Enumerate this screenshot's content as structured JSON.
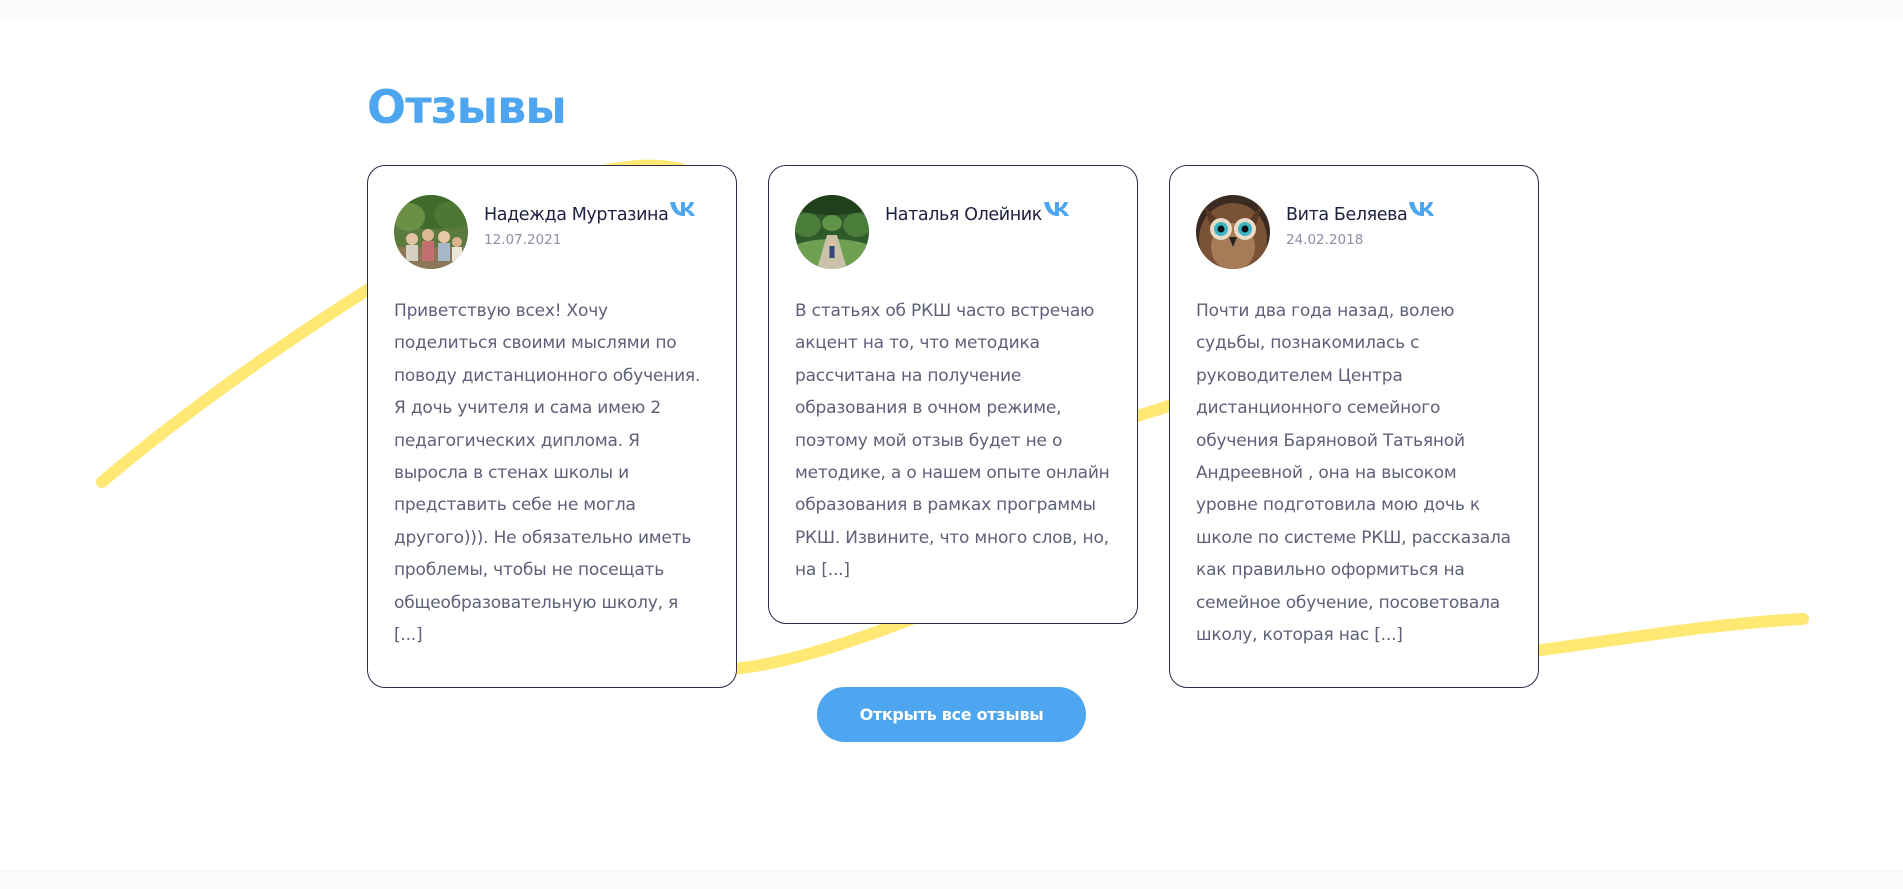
{
  "section": {
    "title": "Отзывы"
  },
  "reviews": [
    {
      "name": "Надежда Муртазина",
      "date": "12.07.2021",
      "text": "Приветствую всех! Хочу поделиться своими мыслями по поводу дистанционного обучения. Я дочь учителя и сама имею 2 педагогических диплома. Я выросла в стенах школы и представить себе не могла другого))). Не обязательно иметь проблемы, чтобы не посещать общеобразовательную школу, я [...]",
      "avatar": "family-photo-avatar",
      "social": "vk-icon"
    },
    {
      "name": "Наталья Олейник",
      "date": "",
      "text": "В статьях об РКШ часто встречаю акцент на то, что методика рассчитана на получение образования в очном режиме, поэтому мой отзыв будет не о методике, а о нашем опыте онлайн образования в рамках программы РКШ. Извините, что много слов, но, на [...]",
      "avatar": "garden-photo-avatar",
      "social": "vk-icon"
    },
    {
      "name": "Вита Беляева",
      "date": "24.02.2018",
      "text": "Почти два года назад, волею судьбы, познакомилась с руководителем Центра дистанционного семейного обучения Баряновой Татьяной Андреевной , она на высоком уровне подготовила мою дочь к школе по системе РКШ, рассказала как правильно оформиться на семейное обучение, посоветовала школу, которая нас [...]",
      "avatar": "owl-photo-avatar",
      "social": "vk-icon"
    }
  ],
  "actions": {
    "open_all_label": "Открыть все отзывы"
  },
  "colors": {
    "accent": "#4da6ef",
    "wave": "#ffe873",
    "card_border": "#2b2e4a",
    "text": "#5e6079",
    "date": "#8d8fa6"
  }
}
